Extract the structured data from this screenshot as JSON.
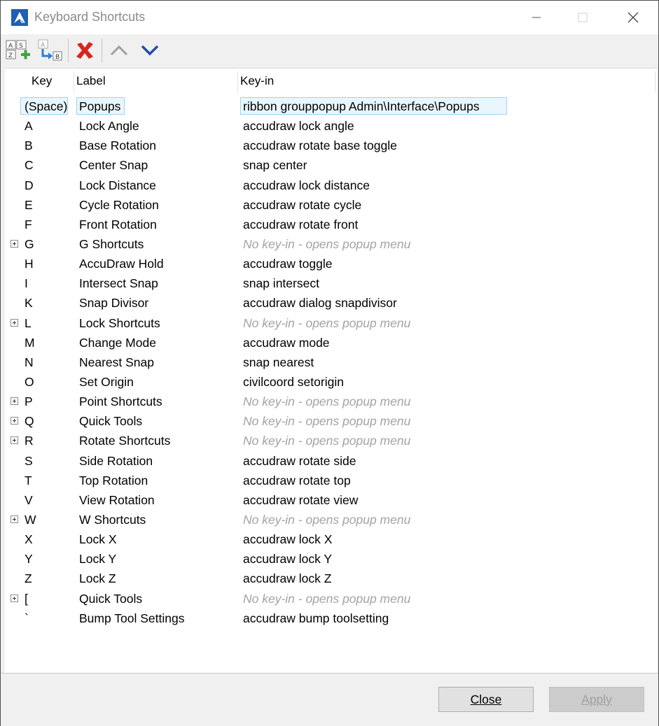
{
  "window": {
    "title": "Keyboard Shortcuts"
  },
  "toolbar": {
    "add_tooltip_icon": "add-shortcut-icon",
    "add_child_icon": "add-child-shortcut-icon",
    "delete_icon": "delete-icon",
    "up_icon": "move-up-icon",
    "down_icon": "move-down-icon"
  },
  "columns": {
    "key": "Key",
    "label": "Label",
    "keyin": "Key-in"
  },
  "rows": [
    {
      "key": "(Space)",
      "label": "Popups",
      "keyin": "ribbon grouppopup Admin\\Interface\\Popups",
      "expand": false,
      "muted": false,
      "selected": true
    },
    {
      "key": "A",
      "label": "Lock Angle",
      "keyin": "accudraw lock angle",
      "expand": false,
      "muted": false
    },
    {
      "key": "B",
      "label": "Base Rotation",
      "keyin": "accudraw rotate base toggle",
      "expand": false,
      "muted": false
    },
    {
      "key": "C",
      "label": "Center Snap",
      "keyin": "snap center",
      "expand": false,
      "muted": false
    },
    {
      "key": "D",
      "label": "Lock Distance",
      "keyin": "accudraw lock distance",
      "expand": false,
      "muted": false
    },
    {
      "key": "E",
      "label": "Cycle Rotation",
      "keyin": "accudraw rotate cycle",
      "expand": false,
      "muted": false
    },
    {
      "key": "F",
      "label": "Front Rotation",
      "keyin": "accudraw rotate front",
      "expand": false,
      "muted": false
    },
    {
      "key": "G",
      "label": "G Shortcuts",
      "keyin": "No key-in - opens popup menu",
      "expand": true,
      "muted": true
    },
    {
      "key": "H",
      "label": "AccuDraw Hold",
      "keyin": "accudraw toggle",
      "expand": false,
      "muted": false
    },
    {
      "key": "I",
      "label": "Intersect Snap",
      "keyin": "snap intersect",
      "expand": false,
      "muted": false
    },
    {
      "key": "K",
      "label": "Snap Divisor",
      "keyin": "accudraw dialog snapdivisor",
      "expand": false,
      "muted": false
    },
    {
      "key": "L",
      "label": "Lock Shortcuts",
      "keyin": "No key-in - opens popup menu",
      "expand": true,
      "muted": true
    },
    {
      "key": "M",
      "label": "Change Mode",
      "keyin": "accudraw mode",
      "expand": false,
      "muted": false
    },
    {
      "key": "N",
      "label": "Nearest Snap",
      "keyin": "snap nearest",
      "expand": false,
      "muted": false
    },
    {
      "key": "O",
      "label": "Set Origin",
      "keyin": "civilcoord setorigin",
      "expand": false,
      "muted": false
    },
    {
      "key": "P",
      "label": "Point Shortcuts",
      "keyin": "No key-in - opens popup menu",
      "expand": true,
      "muted": true
    },
    {
      "key": "Q",
      "label": "Quick Tools",
      "keyin": "No key-in - opens popup menu",
      "expand": true,
      "muted": true
    },
    {
      "key": "R",
      "label": "Rotate Shortcuts",
      "keyin": "No key-in - opens popup menu",
      "expand": true,
      "muted": true
    },
    {
      "key": "S",
      "label": "Side Rotation",
      "keyin": "accudraw rotate side",
      "expand": false,
      "muted": false
    },
    {
      "key": "T",
      "label": "Top Rotation",
      "keyin": "accudraw rotate top",
      "expand": false,
      "muted": false
    },
    {
      "key": "V",
      "label": "View Rotation",
      "keyin": "accudraw rotate view",
      "expand": false,
      "muted": false
    },
    {
      "key": "W",
      "label": "W Shortcuts",
      "keyin": "No key-in - opens popup menu",
      "expand": true,
      "muted": true
    },
    {
      "key": "X",
      "label": "Lock X",
      "keyin": "accudraw lock X",
      "expand": false,
      "muted": false
    },
    {
      "key": "Y",
      "label": "Lock Y",
      "keyin": "accudraw lock Y",
      "expand": false,
      "muted": false
    },
    {
      "key": "Z",
      "label": "Lock Z",
      "keyin": "accudraw lock Z",
      "expand": false,
      "muted": false
    },
    {
      "key": "[",
      "label": "Quick Tools",
      "keyin": "No key-in - opens popup menu",
      "expand": true,
      "muted": true
    },
    {
      "key": "`",
      "label": "Bump Tool Settings",
      "keyin": "accudraw bump toolsetting",
      "expand": false,
      "muted": false
    }
  ],
  "footer": {
    "close_label": "Close",
    "apply_label": "Apply"
  },
  "colors": {
    "accent": "#1f5fb4",
    "delete": "#d9251c",
    "selection_border": "#9fd3f0",
    "muted_text": "#a3a3a3"
  }
}
